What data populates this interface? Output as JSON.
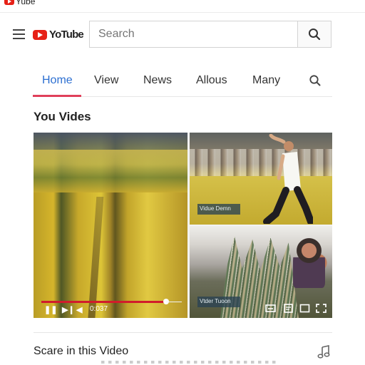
{
  "topbar": {
    "logo_text": "Yube"
  },
  "header": {
    "logo_text": "YoTube",
    "search": {
      "placeholder": "Search"
    }
  },
  "tabs": [
    {
      "label": "Home",
      "active": true
    },
    {
      "label": "View",
      "active": false
    },
    {
      "label": "News",
      "active": false
    },
    {
      "label": "Allous",
      "active": false
    },
    {
      "label": "Many",
      "active": false
    }
  ],
  "section": {
    "title": "You Vides"
  },
  "videos": {
    "main_time": "0:037",
    "captions": [
      {
        "text": "Vidue Demn"
      },
      {
        "text": "Vtder Tuoon"
      }
    ]
  },
  "footer": {
    "share_title": "Scare in this Video"
  },
  "colors": {
    "brand_red": "#e62117",
    "tab_blue": "#2c6fd1",
    "progress_red": "#d11c2b"
  },
  "icons": {
    "menu": "menu-icon",
    "search": "search-icon",
    "play": "play-icon",
    "pause": "pause-icon",
    "volume": "volume-icon",
    "captions": "captions-icon",
    "settings": "settings-icon",
    "miniplayer": "miniplayer-icon",
    "fullscreen": "fullscreen-icon",
    "music": "music-note-icon"
  }
}
